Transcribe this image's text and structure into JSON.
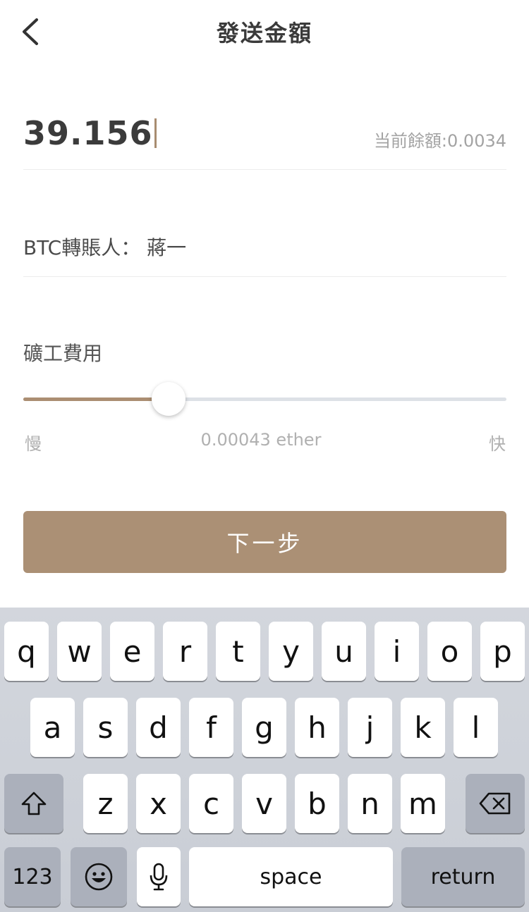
{
  "nav": {
    "title": "發送金額"
  },
  "amount": {
    "value": "39.156",
    "balance": "当前餘額:0.0034"
  },
  "recipient": {
    "text": "BTC轉賬人： 蔣一"
  },
  "fee": {
    "title": "礦工費用",
    "level": 0.3,
    "slow_label": "慢",
    "fast_label": "快",
    "value": "0.00043 ether",
    "colors": {
      "fill": "#ab8e72",
      "track": "#dde1e6"
    }
  },
  "next_button": {
    "label": "下一步",
    "color": "#ab9075"
  },
  "keyboard": {
    "row1": [
      "q",
      "w",
      "e",
      "r",
      "t",
      "y",
      "u",
      "i",
      "o",
      "p"
    ],
    "row2": [
      "a",
      "s",
      "d",
      "f",
      "g",
      "h",
      "j",
      "k",
      "l"
    ],
    "row3": [
      "z",
      "x",
      "c",
      "v",
      "b",
      "n",
      "m"
    ],
    "numbers_label": "123",
    "space_label": "space",
    "return_label": "return",
    "icons": [
      "shift-icon",
      "backspace-icon",
      "emoji-icon",
      "microphone-icon"
    ]
  }
}
